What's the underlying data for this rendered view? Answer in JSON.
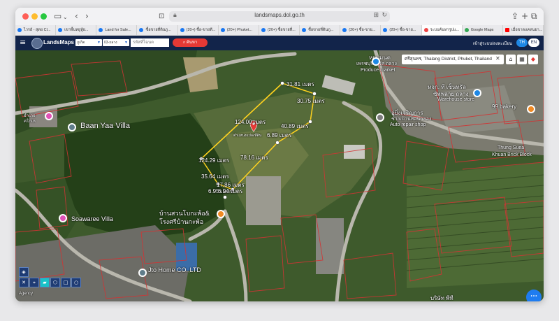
{
  "browser": {
    "url": "landsmaps.dol.go.th",
    "tabs": [
      {
        "label": "ไวรอั - สุดย Cl...",
        "icon": "facebook"
      },
      {
        "label": "เขาพื้นหยูหู้ย...",
        "icon": "facebook"
      },
      {
        "label": "Land for Sale...",
        "icon": "facebook"
      },
      {
        "label": "ซื้อขายที่ดินภู...",
        "icon": "facebook"
      },
      {
        "label": "(20+) ซื้อ-ขายที...",
        "icon": "facebook"
      },
      {
        "label": "(20+) Phuket...",
        "icon": "facebook"
      },
      {
        "label": "(20+) ซื้อขายที่...",
        "icon": "facebook"
      },
      {
        "label": "ซื้อขายที่ดินภู...",
        "icon": "facebook"
      },
      {
        "label": "(20+) ซื้อ-ขาย...",
        "icon": "facebook"
      },
      {
        "label": "(20+) ซื้อ-ขาย...",
        "icon": "facebook"
      },
      {
        "label": "ระบบค้นหารูปแ...",
        "icon": "pin",
        "active": true
      },
      {
        "label": "Google Maps",
        "icon": "maps"
      },
      {
        "label": "เมื่อขาดแคลนยา...",
        "icon": "youtube"
      }
    ]
  },
  "app": {
    "title": "LandsMaps",
    "province": "ภูเก็ต",
    "district": "03-ถลาง",
    "search_placeholder": "รหัสที่โฉนด",
    "search_button": "ค้นหา",
    "login": "เข้าสู่ระบบ/ลงทะเบียน",
    "lang_th": "TH",
    "lang_en": "EN"
  },
  "map": {
    "search_value": "ศรีสุนทร, Thalang District, Phuket, Thailand",
    "places": {
      "baan_yaa": "Baan Yaa Villa",
      "soawaree": "Soawaree Villa",
      "produce_th": "หยบมนด",
      "produce_th2": "เพรชบุรีกาวัส ถลาง",
      "produce_en": "Produce market",
      "warehouse_th": "หจก. ที เซ็นทรัล",
      "warehouse_th2": "ซัพพลาย ถลาง",
      "warehouse_en": "Warehouse store",
      "bakery": "99 bakery",
      "auto_th": "อู่ยิ่งเจริญการ",
      "auto_th2": "ช่างเบ้านหอนกลอง",
      "auto_en": "Auto repair shop",
      "brick_en": "Thung Suea",
      "brick_en2": "Khuan Brick Block",
      "kindergarten_th": "บ้านสวนโบกะพ้อ&",
      "kindergarten_th2": "โรงศรีบ้านกะพ้อ",
      "home_co": "Jto Home CO.,LTD",
      "agency": "Agency",
      "small_left": "อำเภอ",
      "small_left2": "คโกเห",
      "bottom_right": "บริษัท พีที"
    },
    "measurements": {
      "m1": "31.81 เมตร",
      "m2": "30.75 เมตร",
      "m3": "124.00 เมตร",
      "m4": "40.89 เมตร",
      "m5": "6.89 เมตร",
      "m6": "78.16 เมตร",
      "m7": "124.29 เมตร",
      "m8": "35.64 เมตร",
      "m9": "17.86 เมตร",
      "m10": "6.95 เมตร",
      "m11": "6.94 เมตร"
    },
    "parcel_label": "ตำแหน่งแปลงที่ดิน",
    "fab": "⋯"
  }
}
